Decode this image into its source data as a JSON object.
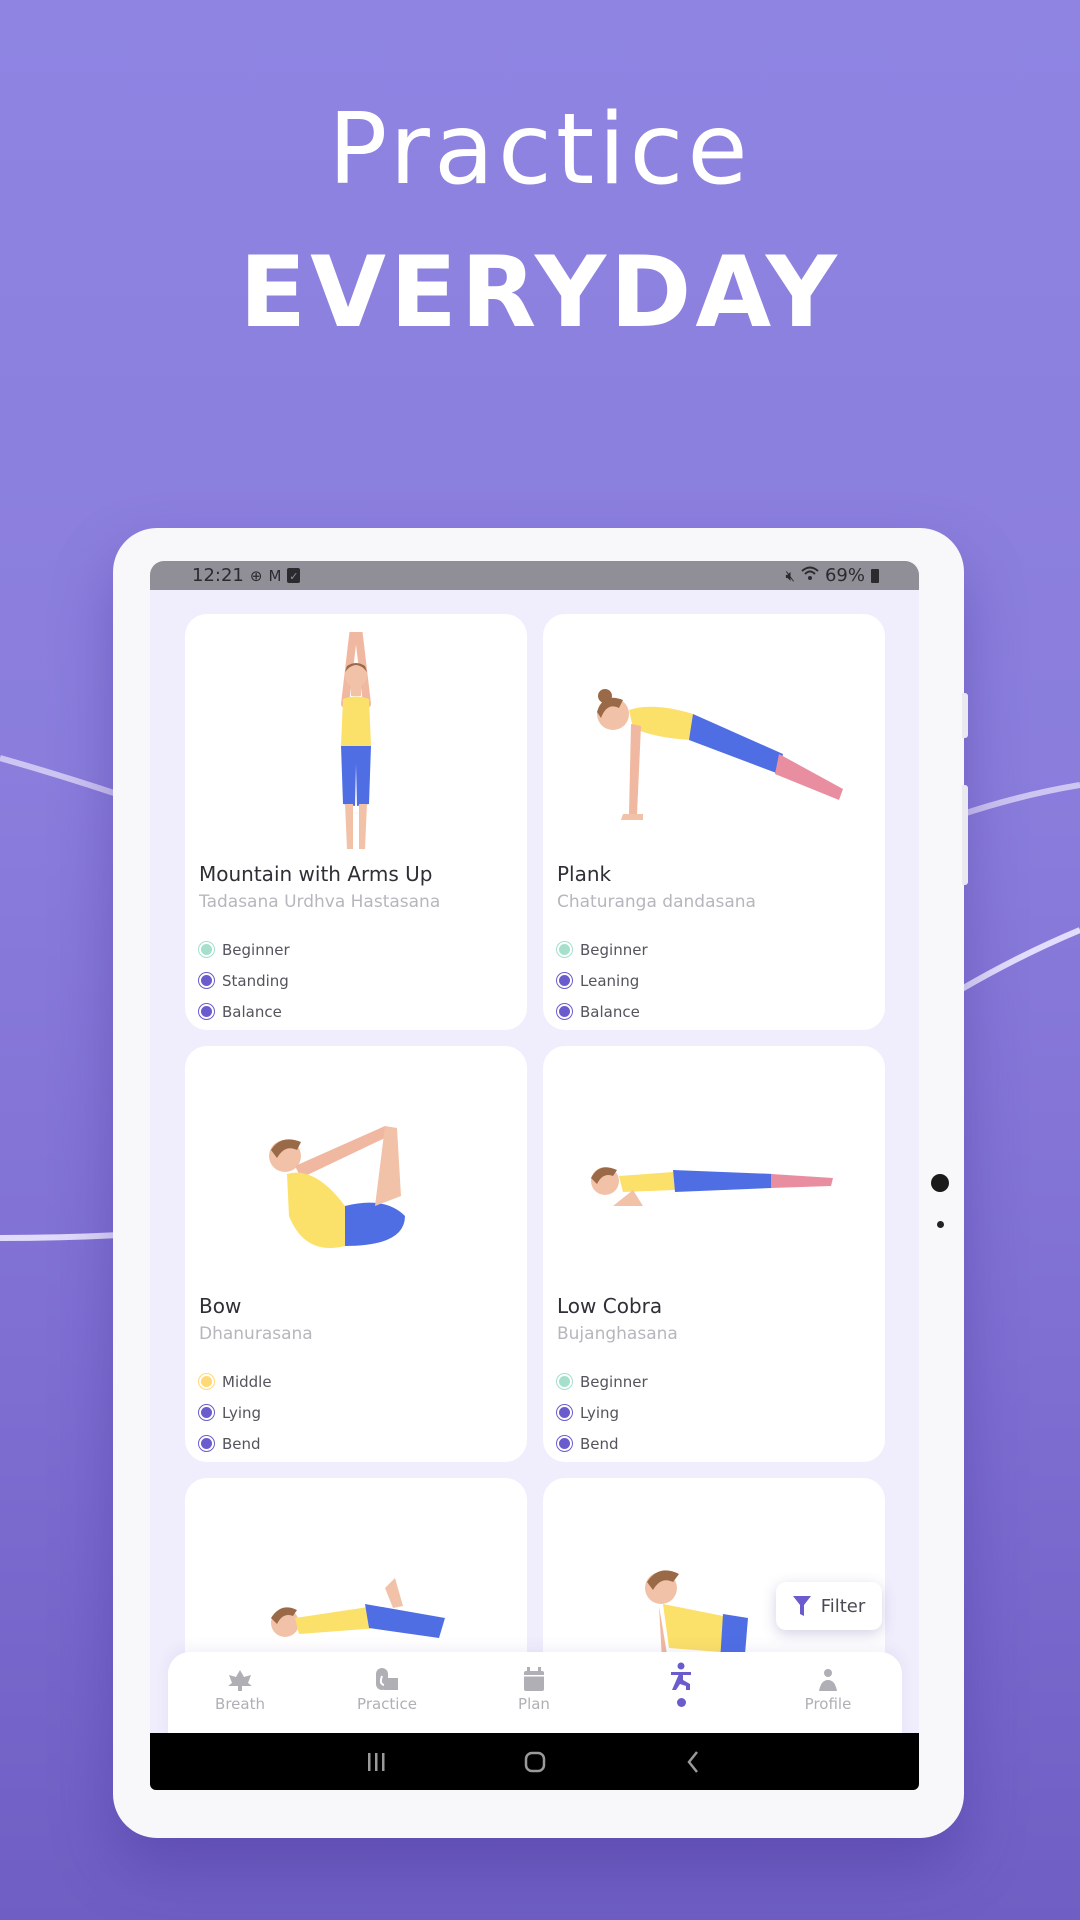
{
  "hero": {
    "line1": "Practice",
    "line2": "EVERYDAY"
  },
  "status_bar": {
    "time": "12:21",
    "left_icons": [
      "globe-icon",
      "gmail-icon",
      "checkbox-icon"
    ],
    "right_icons": [
      "mute-icon",
      "wifi-icon",
      "battery-icon"
    ],
    "battery": "69%"
  },
  "colors": {
    "accent": "#6a5ccc",
    "beginner": "#a6dfcc",
    "middle": "#ffd978",
    "category": "#6a5ccc",
    "background": "#8a7ddc"
  },
  "poses": [
    {
      "name": "Mountain with Arms Up",
      "sanskrit": "Tadasana Urdhva Hastasana",
      "tags": [
        {
          "label": "Beginner",
          "kind": "level-beginner"
        },
        {
          "label": "Standing",
          "kind": "category"
        },
        {
          "label": "Balance",
          "kind": "category"
        }
      ]
    },
    {
      "name": "Plank",
      "sanskrit": "Chaturanga dandasana",
      "tags": [
        {
          "label": "Beginner",
          "kind": "level-beginner"
        },
        {
          "label": "Leaning",
          "kind": "category"
        },
        {
          "label": "Balance",
          "kind": "category"
        }
      ]
    },
    {
      "name": "Bow",
      "sanskrit": "Dhanurasana",
      "tags": [
        {
          "label": "Middle",
          "kind": "level-middle"
        },
        {
          "label": "Lying",
          "kind": "category"
        },
        {
          "label": "Bend",
          "kind": "category"
        }
      ]
    },
    {
      "name": "Low Cobra",
      "sanskrit": "Bujanghasana",
      "tags": [
        {
          "label": "Beginner",
          "kind": "level-beginner"
        },
        {
          "label": "Lying",
          "kind": "category"
        },
        {
          "label": "Bend",
          "kind": "category"
        }
      ]
    }
  ],
  "filter": {
    "label": "Filter",
    "icon": "filter-icon"
  },
  "nav": {
    "items": [
      {
        "label": "Breath",
        "icon": "lotus-icon",
        "active": false
      },
      {
        "label": "Practice",
        "icon": "yoga-mat-icon",
        "active": false
      },
      {
        "label": "Plan",
        "icon": "calendar-icon",
        "active": false
      },
      {
        "label": "",
        "icon": "yoga-pose-icon",
        "active": true
      },
      {
        "label": "Profile",
        "icon": "person-icon",
        "active": false
      }
    ]
  },
  "system_nav": [
    "recents-icon",
    "home-icon",
    "back-icon"
  ]
}
